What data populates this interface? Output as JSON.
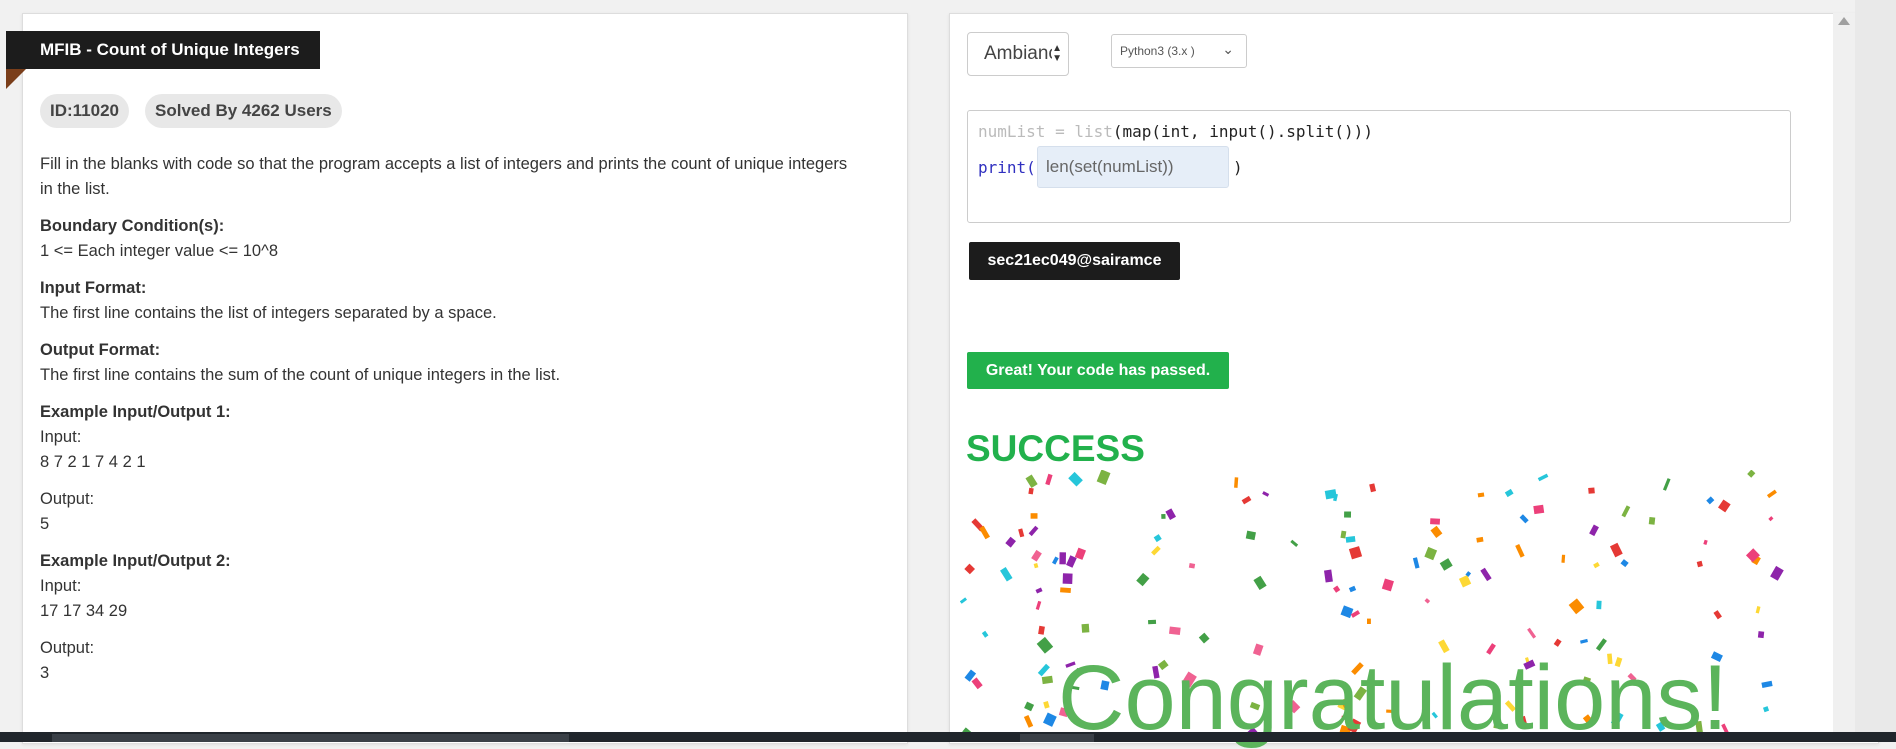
{
  "problem": {
    "title": "MFIB - Count of Unique Integers",
    "id_chip": "ID:11020",
    "solved_chip": "Solved By 4262 Users",
    "description": "Fill in the blanks with code so that the program accepts a list of integers and prints the count of unique integers in the list.",
    "boundary_heading": "Boundary Condition(s):",
    "boundary_text": "1 <= Each integer value <= 10^8",
    "input_heading": "Input Format:",
    "input_text": "The first line contains the list of integers separated by a space.",
    "output_heading": "Output Format:",
    "output_text": "The first line contains the sum of the count of unique integers in the list.",
    "example1_heading": "Example Input/Output 1:",
    "example1_input_label": "Input:",
    "example1_input": "8 7 2 1 7 4 2 1",
    "example1_output_label": "Output:",
    "example1_output": "5",
    "example2_heading": "Example Input/Output 2:",
    "example2_input_label": "Input:",
    "example2_input": "17 17 34 29",
    "example2_output_label": "Output:",
    "example2_output": "3"
  },
  "editor": {
    "theme_value": "Ambiance",
    "language_value": "Python3 (3.x )",
    "line1": {
      "blank1": "numList = list",
      "rest": "(map(int, input().split()))"
    },
    "line2": {
      "prefix": "print(",
      "answer": "len(set(numList))",
      "suffix": ")"
    }
  },
  "result": {
    "user_tag": "sec21ec049@sairamce",
    "pass_message": "Great! Your code has passed.",
    "success_label": "SUCCESS",
    "congrats_label": "Congratulations!"
  },
  "colors": {
    "success_green": "#22b14c",
    "ribbon_dark": "#1c1c1c",
    "congrats_green": "#5bb45b"
  },
  "icons": {
    "theme_arrows": "up-down-arrows-icon",
    "lang_chevron": "chevron-down-icon",
    "scroll_up": "scroll-up-arrow-icon"
  }
}
